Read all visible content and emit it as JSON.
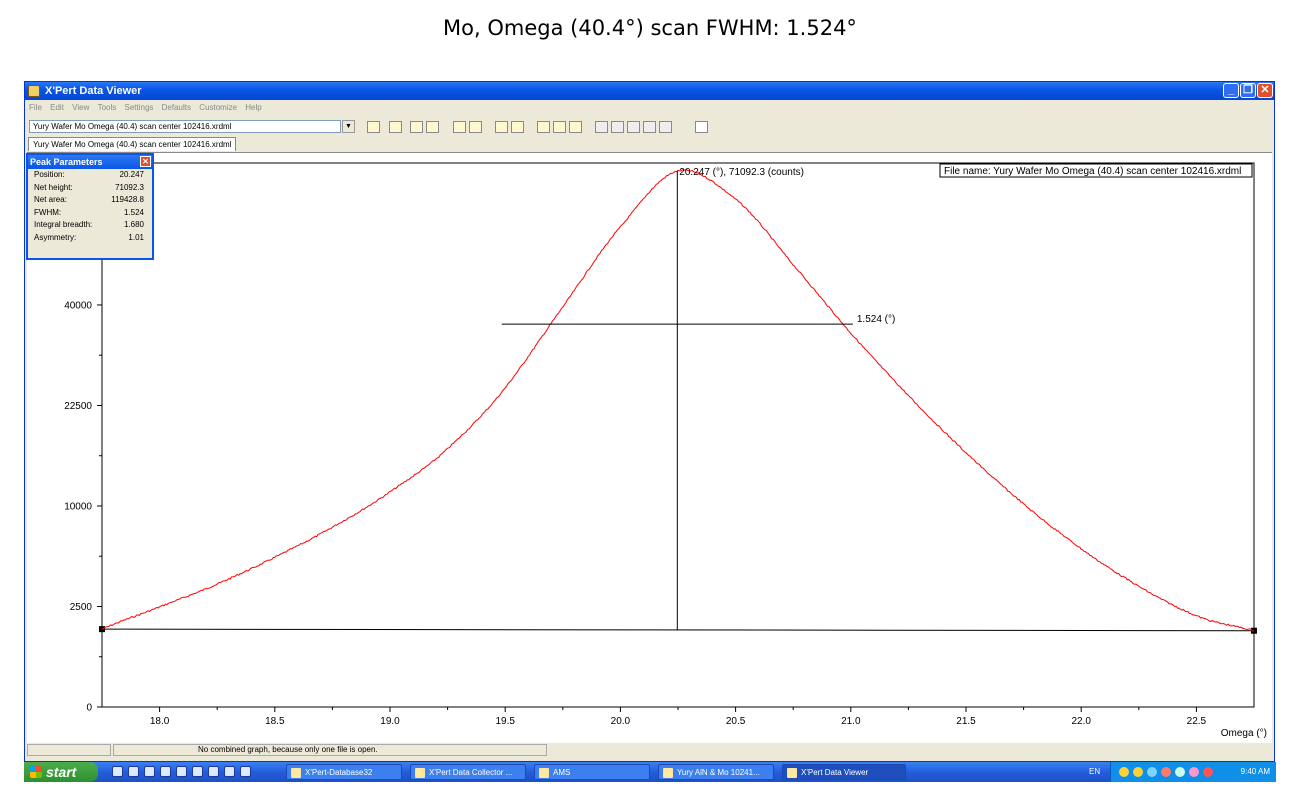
{
  "heading": "Mo, Omega (40.4°) scan FWHM: 1.524°",
  "window": {
    "title": "X'Pert Data Viewer",
    "menu": [
      "File",
      "Edit",
      "View",
      "Tools",
      "Settings",
      "Defaults",
      "Customize",
      "Help"
    ],
    "file_combo_value": "Yury Wafer Mo Omega (40.4) scan center 102416.xrdml",
    "file_tab": "Yury Wafer Mo Omega (40.4) scan center 102416.xrdml",
    "status_text": "No combined graph, because only one file is open."
  },
  "peak_parameters": {
    "title": "Peak Parameters",
    "rows": [
      {
        "label": "Position:",
        "value": "20.247"
      },
      {
        "label": "Net height:",
        "value": "71092.3"
      },
      {
        "label": "Net area:",
        "value": "119428.8"
      },
      {
        "label": "FWHM:",
        "value": "1.524"
      },
      {
        "label": "Integral breadth:",
        "value": "1.680"
      },
      {
        "label": "Asymmetry:",
        "value": "1.01"
      }
    ]
  },
  "chart_data": {
    "type": "line",
    "file_name_label": "File name: Yury Wafer Mo Omega (40.4) scan center 102416.xrdml",
    "xlabel": "Omega (°)",
    "ylabel": "",
    "xlim": [
      17.75,
      22.75
    ],
    "x_ticks": [
      "18.0",
      "18.5",
      "19.0",
      "19.5",
      "20.0",
      "20.5",
      "21.0",
      "21.5",
      "22.0",
      "22.5"
    ],
    "x_tick_values": [
      18.0,
      18.5,
      19.0,
      19.5,
      20.0,
      20.5,
      21.0,
      21.5,
      22.0,
      22.5
    ],
    "y_scale": "square-root",
    "ylim": [
      0,
      71092.3
    ],
    "y_ticks": [
      "0",
      "2500",
      "10000",
      "22500",
      "40000"
    ],
    "y_tick_values": [
      0,
      2500,
      10000,
      22500,
      40000
    ],
    "series": [
      {
        "color": "#ff0000",
        "x": [
          17.75,
          18.0,
          18.25,
          18.5,
          18.75,
          19.0,
          19.25,
          19.5,
          19.75,
          20.0,
          20.25,
          20.5,
          20.75,
          21.0,
          21.25,
          21.5,
          21.75,
          22.0,
          22.25,
          22.5,
          22.75
        ],
        "y": [
          1500,
          2480,
          3740,
          5540,
          8000,
          11450,
          16500,
          25200,
          39600,
          57000,
          71092,
          63800,
          48400,
          34600,
          24000,
          16000,
          10200,
          6200,
          3600,
          2060,
          1440
        ]
      }
    ],
    "background_line": {
      "x": [
        17.75,
        22.75
      ],
      "y": [
        1500,
        1440
      ]
    },
    "peak": {
      "x": 20.247,
      "y": 71092.3,
      "label": "20.247 (°), 71092.3 (counts)"
    },
    "fwhm": {
      "x_start": 19.485,
      "x_end": 21.009,
      "y": 36266,
      "label": "1.524 (°)"
    }
  },
  "taskbar": {
    "start_label": "start",
    "tasks": [
      {
        "label": "X'Pert-Database32",
        "active": false
      },
      {
        "label": "X'Pert Data Collector ...",
        "active": false
      },
      {
        "label": "AMS",
        "active": false
      },
      {
        "label": "Yury AlN & Mo 10241...",
        "active": false
      },
      {
        "label": "X'Pert Data Viewer",
        "active": true
      }
    ],
    "language": "EN",
    "clock": "9:40 AM"
  }
}
